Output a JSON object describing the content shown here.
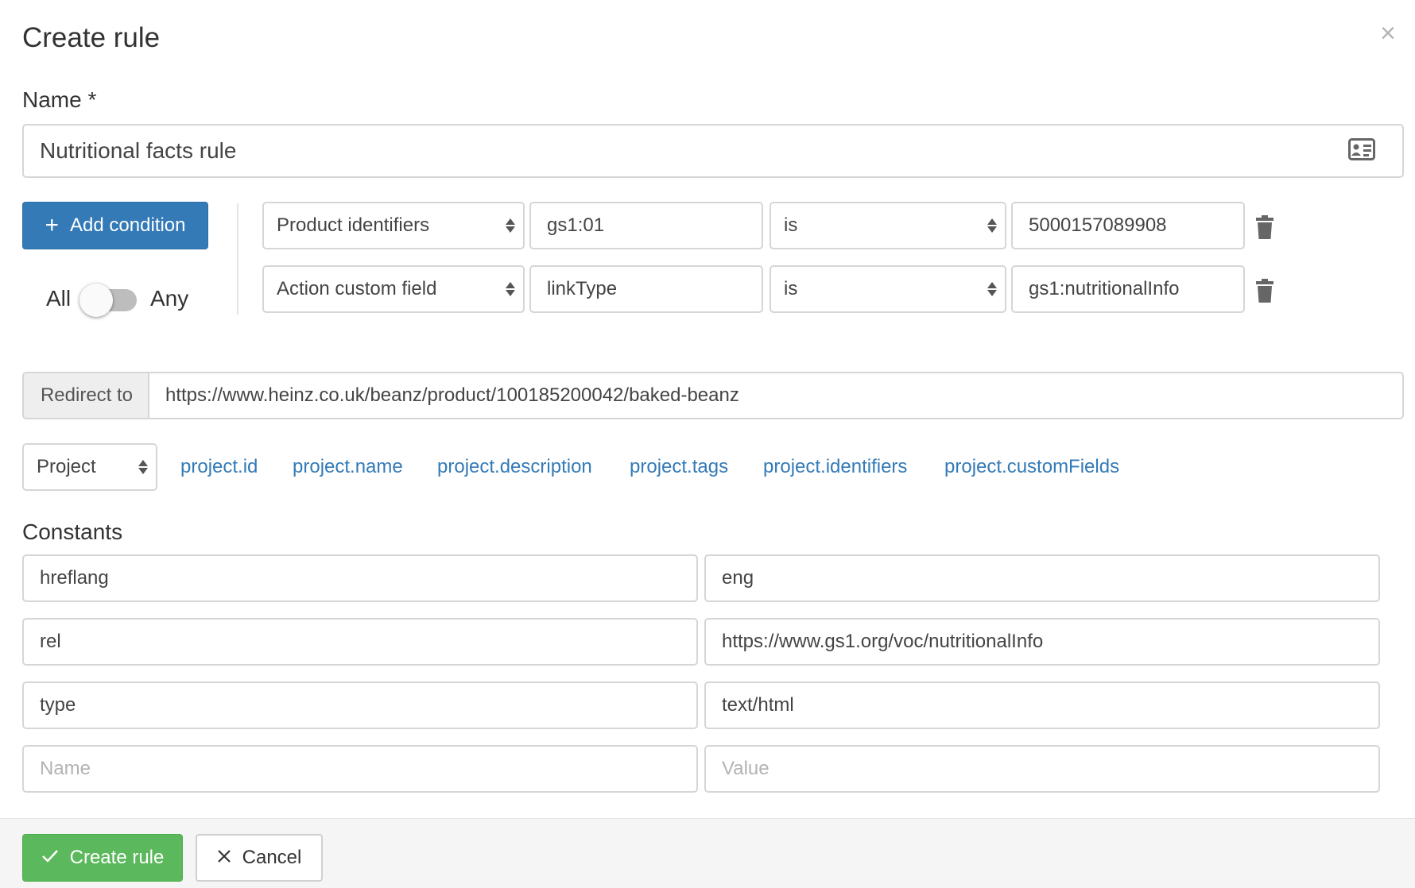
{
  "dialog": {
    "title": "Create rule",
    "close_glyph": "×"
  },
  "name_field": {
    "label": "Name *",
    "value": "Nutritional facts rule",
    "icon": "contact-card-icon"
  },
  "conditions": {
    "add_button_label": "Add condition",
    "match_all_label": "All",
    "match_any_label": "Any",
    "match_mode": "all",
    "rows": [
      {
        "field": "Product identifiers",
        "key": "gs1:01",
        "operator": "is",
        "value": "5000157089908"
      },
      {
        "field": "Action custom field",
        "key": "linkType",
        "operator": "is",
        "value": "gs1:nutritionalInfo"
      }
    ]
  },
  "redirect": {
    "addon_label": "Redirect to",
    "url": "https://www.heinz.co.uk/beanz/product/100185200042/baked-beanz"
  },
  "variables": {
    "scope_select": "Project",
    "links": [
      "project.id",
      "project.name",
      "project.description",
      "project.tags",
      "project.identifiers",
      "project.customFields"
    ]
  },
  "constants": {
    "heading": "Constants",
    "rows": [
      {
        "name": "hreflang",
        "value": "eng"
      },
      {
        "name": "rel",
        "value": "https://www.gs1.org/voc/nutritionalInfo"
      },
      {
        "name": "type",
        "value": "text/html"
      }
    ],
    "new_row": {
      "name_placeholder": "Name",
      "value_placeholder": "Value"
    }
  },
  "footer": {
    "create_label": "Create rule",
    "cancel_label": "Cancel"
  },
  "colors": {
    "primary": "#337ab7",
    "success": "#5cb85c",
    "link": "#337ab7"
  }
}
